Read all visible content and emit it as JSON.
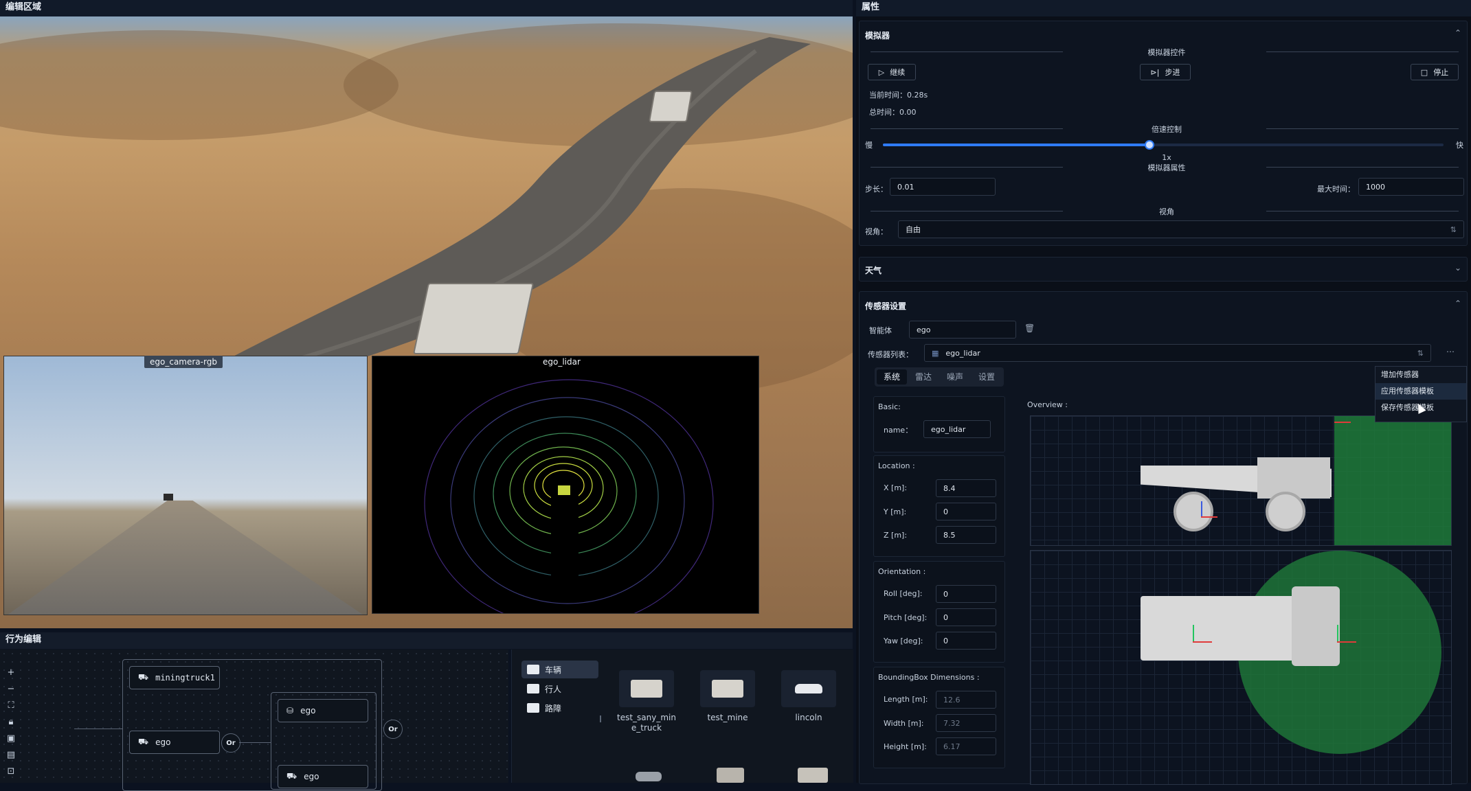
{
  "editor": {
    "title": "编辑区域"
  },
  "views": {
    "camera_label": "ego_camera-rgb",
    "lidar_label": "ego_lidar"
  },
  "behavior": {
    "title": "行为编辑",
    "nodes": {
      "root": "miningtruck1",
      "left": "ego",
      "right_top": "ego",
      "right_bottom": "ego"
    },
    "or_labels": [
      "Or",
      "Or"
    ],
    "tools": [
      "plus-icon",
      "minus-icon",
      "fit-icon",
      "lock-icon",
      "frame-icon",
      "layout-icon",
      "export-icon"
    ]
  },
  "assets": {
    "folders": [
      {
        "label": "车辆",
        "active": true
      },
      {
        "label": "行人",
        "active": false
      },
      {
        "label": "路障",
        "active": false
      }
    ],
    "cards": [
      {
        "label": "test_sany_mine_truck"
      },
      {
        "label": "test_mine"
      },
      {
        "label": "lincoln"
      }
    ]
  },
  "properties": {
    "title": "属性",
    "simulator": {
      "head": "模拟器",
      "controls_title": "模拟器控件",
      "continue_label": "继续",
      "step_label": "步进",
      "stop_label": "停止",
      "current_time": "当前时间：0.28s",
      "total_time": "总时间：0.00",
      "speed_title": "倍速控制",
      "slow_label": "慢",
      "fast_label": "快",
      "speed_value": "1x",
      "speed_fraction": 0.475,
      "props_title": "模拟器属性",
      "step_size_label": "步长：",
      "step_size_value": "0.01",
      "max_time_label": "最大时间：",
      "max_time_value": "1000",
      "view_title": "视角",
      "view_label": "视角：",
      "view_value": "自由"
    },
    "weather": {
      "head": "天气"
    },
    "sensor": {
      "head": "传感器设置",
      "agent_label": "智能体",
      "agent_value": "ego",
      "list_label": "传感器列表：",
      "list_value": "ego_lidar",
      "tabs": [
        {
          "label": "系统",
          "active": true
        },
        {
          "label": "雷达",
          "active": false
        },
        {
          "label": "噪声",
          "active": false
        },
        {
          "label": "设置",
          "active": false
        }
      ],
      "menu": [
        {
          "label": "增加传感器"
        },
        {
          "label": "应用传感器模板"
        },
        {
          "label": "保存传感器模板"
        }
      ],
      "basic_title": "Basic:",
      "name_label": "name：",
      "name_value": "ego_lidar",
      "location_title": "Location :",
      "x_label": "X [m]:",
      "x_value": "8.4",
      "y_label": "Y [m]:",
      "y_value": "0",
      "z_label": "Z [m]:",
      "z_value": "8.5",
      "orientation_title": "Orientation :",
      "roll_label": "Roll [deg]:",
      "roll_value": "0",
      "pitch_label": "Pitch [deg]:",
      "pitch_value": "0",
      "yaw_label": "Yaw [deg]:",
      "yaw_value": "0",
      "bbox_title": "BoundingBox Dimensions :",
      "length_label": "Length [m]:",
      "length_value": "12.6",
      "width_label": "Width [m]:",
      "width_value": "7.32",
      "height_label": "Height [m]:",
      "height_value": "6.17",
      "overview_title": "Overview :"
    }
  },
  "colors": {
    "accent": "#2f7bf5",
    "sensor_green": "#1f7a3a"
  }
}
